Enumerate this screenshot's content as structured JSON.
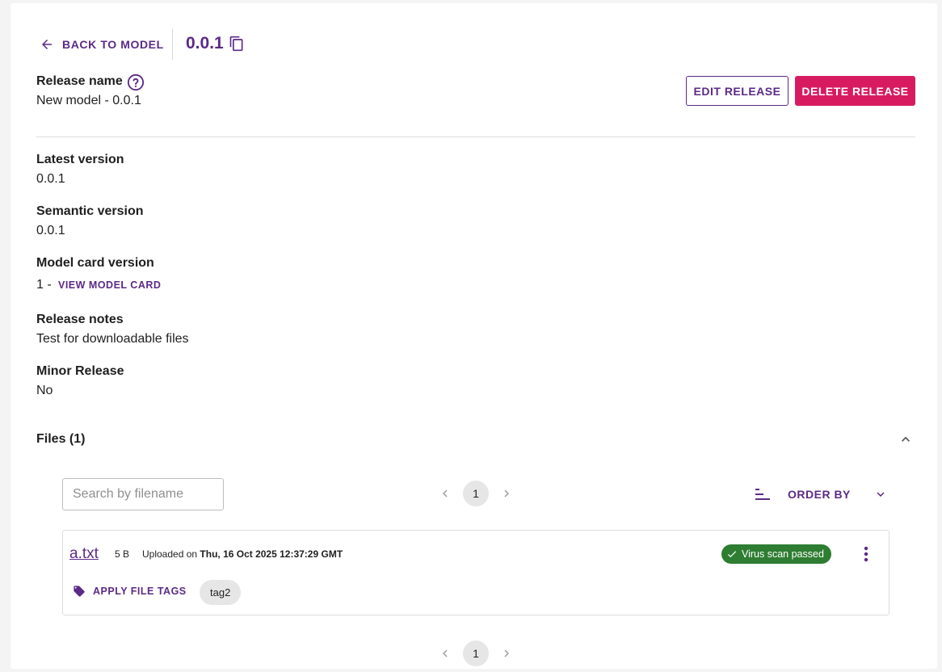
{
  "header": {
    "back_label": "BACK TO MODEL",
    "version_title": "0.0.1"
  },
  "release": {
    "name_label": "Release name",
    "name_value": "New model - 0.0.1",
    "edit_label": "EDIT RELEASE",
    "delete_label": "DELETE RELEASE"
  },
  "fields": {
    "latest_version_label": "Latest version",
    "latest_version_value": "0.0.1",
    "semantic_version_label": "Semantic version",
    "semantic_version_value": "0.0.1",
    "model_card_version_label": "Model card version",
    "model_card_version_value": "1 -",
    "view_model_card_label": "VIEW MODEL CARD",
    "release_notes_label": "Release notes",
    "release_notes_value": "Test for downloadable files",
    "minor_release_label": "Minor Release",
    "minor_release_value": "No"
  },
  "files": {
    "title": "Files (1)",
    "search_placeholder": "Search by filename",
    "search_value": "",
    "current_page": "1",
    "order_by_label": "ORDER BY",
    "items": [
      {
        "name": "a.txt",
        "size": "5 B",
        "uploaded_prefix": "Uploaded on",
        "uploaded_date": "Thu, 16 Oct 2025 12:37:29 GMT",
        "scan_status": "Virus scan passed",
        "apply_tags_label": "APPLY FILE TAGS",
        "tags": [
          "tag2"
        ]
      }
    ]
  },
  "colors": {
    "accent": "#5b2a86",
    "danger": "#d81b60",
    "success": "#2e7d32"
  },
  "icons": {
    "back": "arrow-left-icon",
    "copy": "copy-icon",
    "help": "help-circle-icon",
    "collapse": "chevron-up-icon",
    "sort": "sort-icon",
    "order_chevron": "chevron-down-icon",
    "prev": "chevron-left-icon",
    "next": "chevron-right-icon",
    "scan": "check-icon",
    "more": "more-vertical-icon",
    "tag": "tag-icon"
  }
}
